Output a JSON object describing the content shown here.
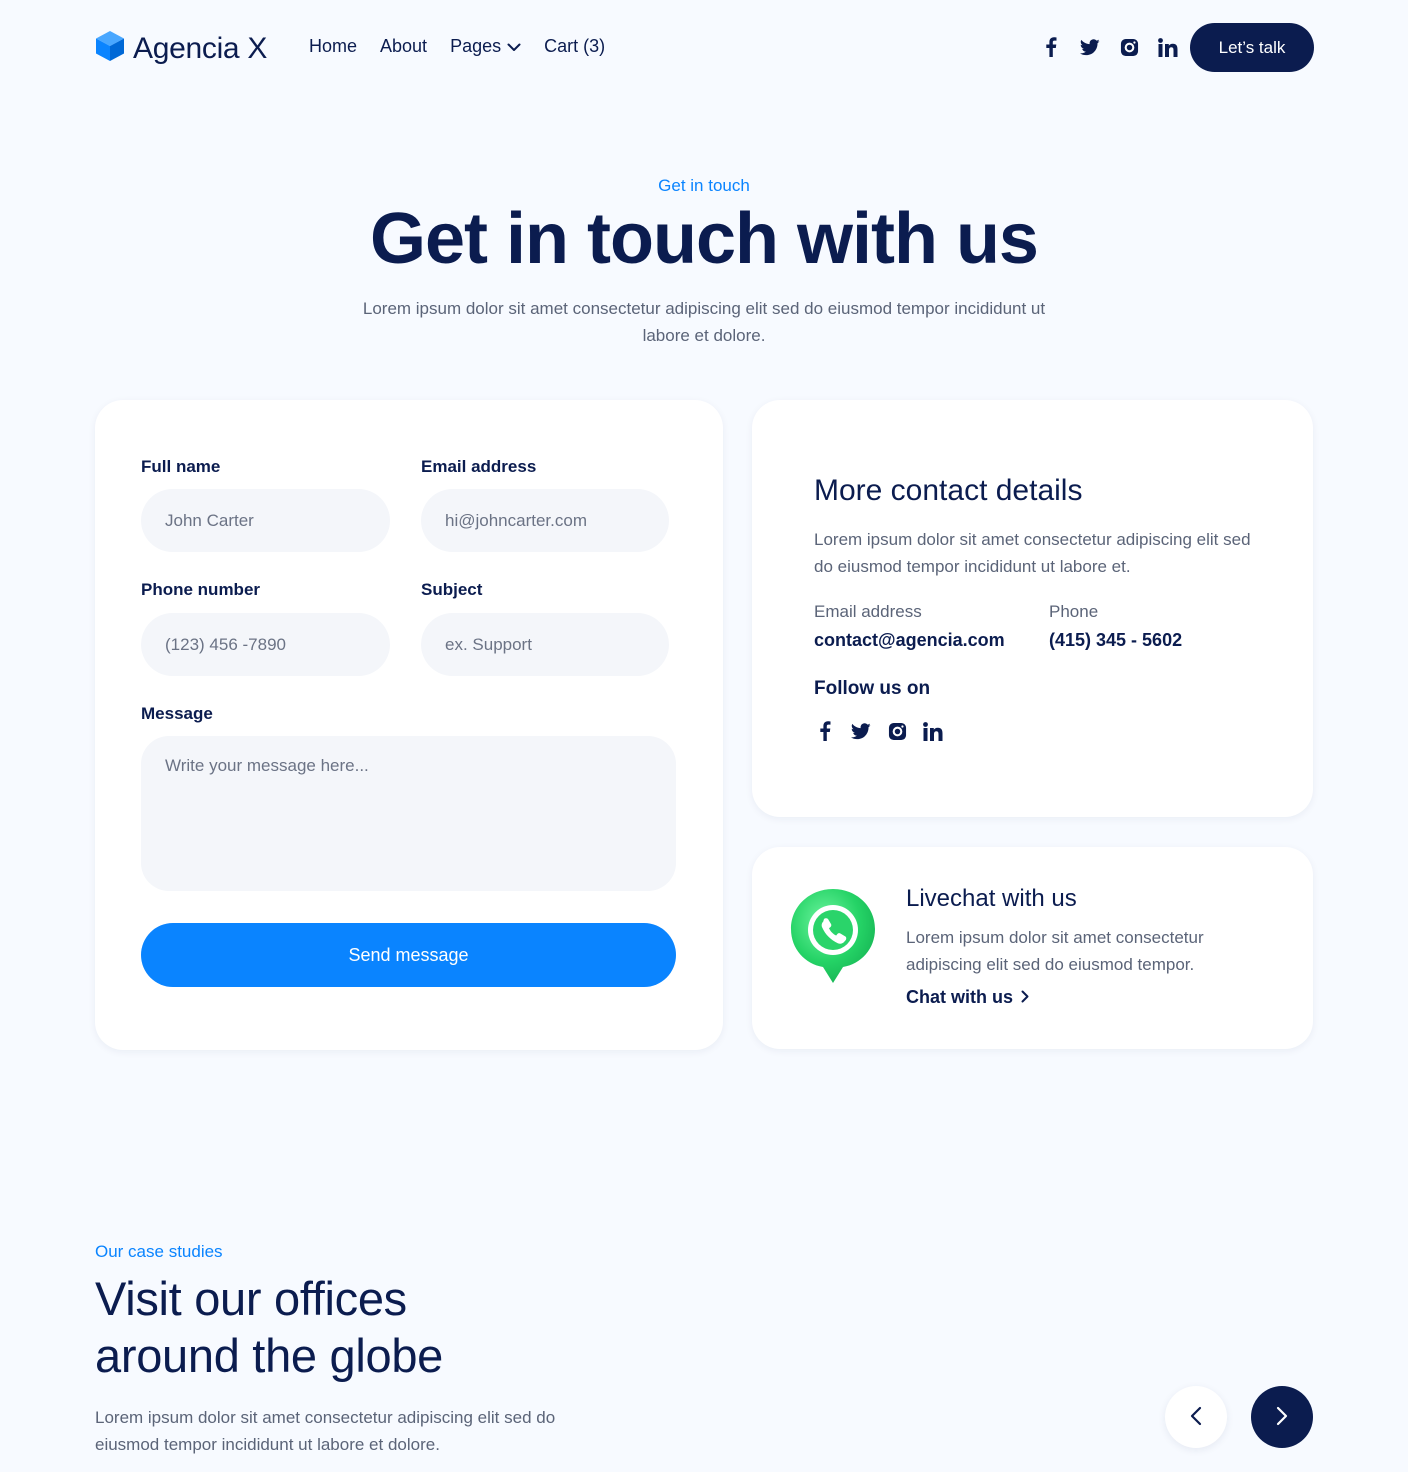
{
  "header": {
    "brand": "Agencia X",
    "nav": [
      {
        "label": "Home"
      },
      {
        "label": "About"
      },
      {
        "label": "Pages"
      },
      {
        "label": "Cart (3)"
      }
    ],
    "social_icons": [
      "facebook-icon",
      "twitter-icon",
      "instagram-icon",
      "linkedin-icon"
    ],
    "cta": "Let’s talk"
  },
  "hero": {
    "eyebrow": "Get in touch",
    "title": "Get in touch with us",
    "subtitle": "Lorem ipsum dolor sit amet consectetur adipiscing elit sed do eiusmod tempor incididunt ut labore et dolore."
  },
  "form": {
    "full_name_label": "Full name",
    "full_name_placeholder": "John Carter",
    "email_label": "Email address",
    "email_placeholder": "hi@johncarter.com",
    "phone_label": "Phone number",
    "phone_placeholder": "(123) 456 -7890",
    "subject_label": "Subject",
    "subject_placeholder": "ex. Support",
    "message_label": "Message",
    "message_placeholder": "Write your message here...",
    "submit": "Send message"
  },
  "details": {
    "title": "More contact details",
    "text": "Lorem ipsum dolor sit amet consectetur adipiscing elit sed do eiusmod tempor incididunt ut labore et.",
    "email_label": "Email address",
    "email_value": "contact@agencia.com",
    "phone_label": "Phone",
    "phone_value": "(415) 345 - 5602",
    "follow_label": "Follow us on"
  },
  "livechat": {
    "title": "Livechat with us",
    "text": "Lorem ipsum dolor sit amet consectetur adipiscing elit sed do eiusmod tempor.",
    "link": "Chat with us"
  },
  "case_studies": {
    "eyebrow": "Our case studies",
    "title_line1": "Visit our offices",
    "title_line2": "around the globe",
    "text": "Lorem ipsum dolor sit amet consectetur adipiscing elit sed do eiusmod tempor incididunt ut labore et dolore."
  },
  "colors": {
    "accent": "#0a84ff",
    "navy": "#0b1c4f",
    "background": "#f7faff",
    "whatsapp_green": "#25d366"
  }
}
